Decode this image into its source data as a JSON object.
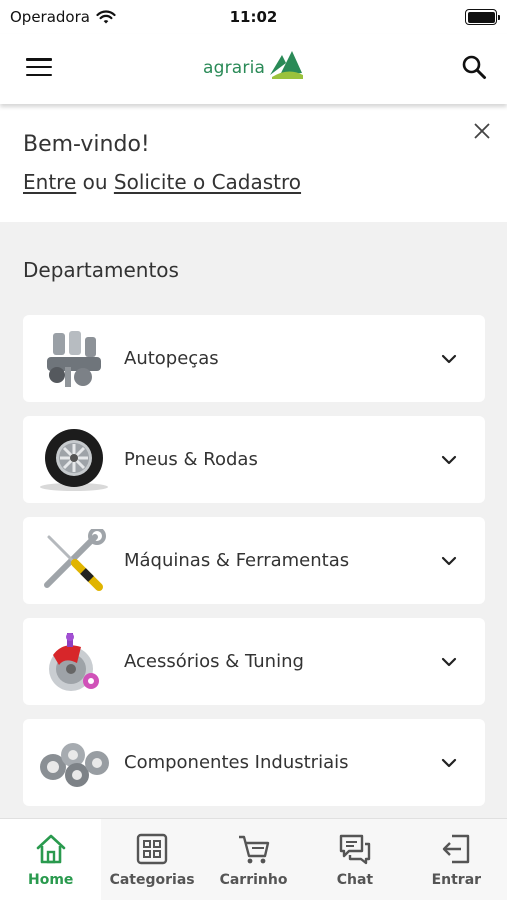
{
  "status": {
    "carrier": "Operadora",
    "time": "11:02"
  },
  "header": {
    "logo_text": "agraria"
  },
  "welcome": {
    "title": "Bem-vindo!",
    "login_link": "Entre",
    "connector": " ou ",
    "register_link": "Solicite o Cadastro"
  },
  "departments": {
    "title": "Departamentos",
    "items": [
      {
        "label": "Autopeças",
        "icon": "engine-parts-image"
      },
      {
        "label": "Pneus & Rodas",
        "icon": "tire-image"
      },
      {
        "label": "Máquinas & Ferramentas",
        "icon": "tools-image"
      },
      {
        "label": "Acessórios & Tuning",
        "icon": "brake-tuning-image"
      },
      {
        "label": "Componentes Industriais",
        "icon": "bearings-image"
      }
    ]
  },
  "nav": {
    "items": [
      {
        "label": "Home",
        "icon": "home-icon",
        "active": true
      },
      {
        "label": "Categorias",
        "icon": "grid-icon"
      },
      {
        "label": "Carrinho",
        "icon": "cart-icon"
      },
      {
        "label": "Chat",
        "icon": "chat-icon"
      },
      {
        "label": "Entrar",
        "icon": "login-icon"
      }
    ]
  },
  "colors": {
    "brand_green": "#2a8a57",
    "active_nav": "#2a9a4e",
    "background": "#f1f1f1"
  }
}
